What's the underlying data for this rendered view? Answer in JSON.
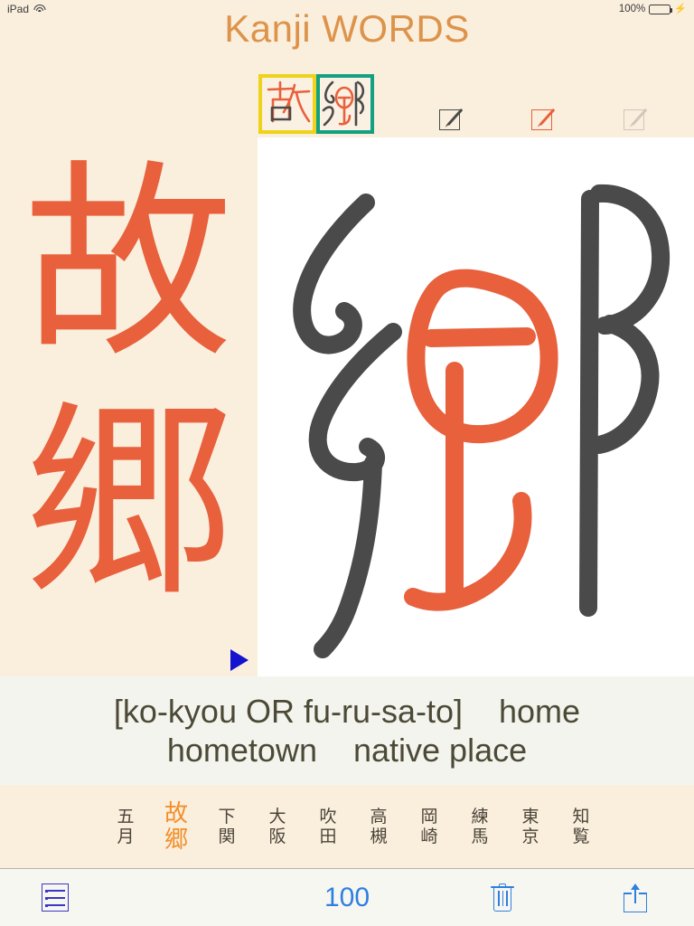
{
  "status_bar": {
    "device": "iPad",
    "wifi_icon": "wifi-icon",
    "battery_percent": "100%",
    "battery_icon": "battery-icon",
    "charging_icon": "lightning-bolt-icon"
  },
  "header": {
    "title": "Kanji WORDS",
    "title_color": "#dd9349"
  },
  "thumbnails": [
    {
      "char": "故",
      "border_color": "#efd21a",
      "name": "thumbnail-ko"
    },
    {
      "char": "郷",
      "border_color": "#13a083",
      "name": "thumbnail-kyou"
    }
  ],
  "edit_tools": [
    {
      "name": "edit-pencil-dark",
      "color": "#4a4a4a"
    },
    {
      "name": "edit-pencil-orange",
      "color": "#e8603c"
    },
    {
      "name": "edit-pencil-grey",
      "color": "#cfc7bd"
    }
  ],
  "reference": {
    "char_1": "故",
    "char_2": "郷",
    "color": "#e8603c",
    "play_icon": "play-triangle-icon",
    "play_color": "#1414cf"
  },
  "canvas": {
    "background": "#ffffff",
    "ink_dark": "#4a4a4a",
    "ink_orange": "#e8603c",
    "drawn_character": "郷"
  },
  "reading": {
    "line_1": "[ko-kyou OR fu-ru-sa-to]    home",
    "line_2": "hometown    native place",
    "color": "#4c4a36"
  },
  "word_grid": {
    "active_index": 1,
    "active_color": "#f28f2b",
    "words": [
      {
        "top": "五",
        "bottom": "月",
        "active": false
      },
      {
        "top": "故",
        "bottom": "郷",
        "active": true
      },
      {
        "top": "下",
        "bottom": "関",
        "active": false
      },
      {
        "top": "大",
        "bottom": "阪",
        "active": false
      },
      {
        "top": "吹",
        "bottom": "田",
        "active": false
      },
      {
        "top": "高",
        "bottom": "槻",
        "active": false
      },
      {
        "top": "岡",
        "bottom": "崎",
        "active": false
      },
      {
        "top": "練",
        "bottom": "馬",
        "active": false
      },
      {
        "top": "東",
        "bottom": "京",
        "active": false
      },
      {
        "top": "知",
        "bottom": "覧",
        "active": false
      }
    ]
  },
  "toolbar": {
    "list_icon": "list-icon",
    "count": "100",
    "count_color": "#2f7fe0",
    "trash_icon": "trash-icon",
    "share_icon": "share-icon"
  }
}
